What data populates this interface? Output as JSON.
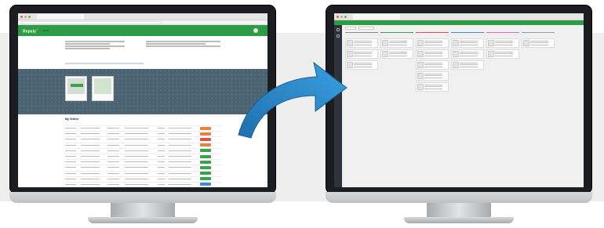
{
  "left_screen": {
    "browser_tab_title": "",
    "header": {
      "logo": "Repsly",
      "logo_mark": "+",
      "action_button": "",
      "user_name": ""
    },
    "info_left_heading": "",
    "info_right_heading": "",
    "banner_title": "",
    "products": [
      {
        "label": "",
        "button": ""
      },
      {
        "label": ""
      }
    ],
    "orders_title": "My Orders",
    "order_columns": [
      "",
      "",
      "",
      "",
      "",
      "",
      ""
    ],
    "order_rows": [
      {
        "badge_color": "#e8833a"
      },
      {
        "badge_color": "#e8833a"
      },
      {
        "badge_color": "#e0514b"
      },
      {
        "badge_color": "#e8833a"
      },
      {
        "badge_color": "#3aa14d"
      },
      {
        "badge_color": "#3aa14d"
      },
      {
        "badge_color": "#3aa14d"
      },
      {
        "badge_color": "#3aa14d"
      },
      {
        "badge_color": "#3aa14d"
      },
      {
        "badge_color": "#3aa14d"
      },
      {
        "badge_color": "#3a8fd6"
      }
    ]
  },
  "right_screen": {
    "browser_tab_title": "",
    "header": {
      "logo": "Repsly",
      "logo_mark": "+",
      "action_button": ""
    },
    "columns": [
      {
        "title": "",
        "count": "",
        "color": "#8a8a8a",
        "cards": 3
      },
      {
        "title": "",
        "count": "",
        "color": "#3aa14d",
        "cards": 2
      },
      {
        "title": "",
        "count": "",
        "color": "#e0514b",
        "cards": 5
      },
      {
        "title": "",
        "count": "",
        "color": "#3a8fd6",
        "cards": 3
      },
      {
        "title": "",
        "count": "",
        "color": "#d36cc7",
        "cards": 2
      },
      {
        "title": "",
        "count": "",
        "color": "#9a9a9a",
        "cards": 1
      }
    ]
  },
  "colors": {
    "brand_green": "#2d9c45",
    "arrow_blue": "#2b86c8",
    "banner_slate": "#4b6372",
    "monitor_bezel": "#1c1d20"
  },
  "icons": [
    "arrow-curved-right-icon",
    "monitor-icon"
  ]
}
